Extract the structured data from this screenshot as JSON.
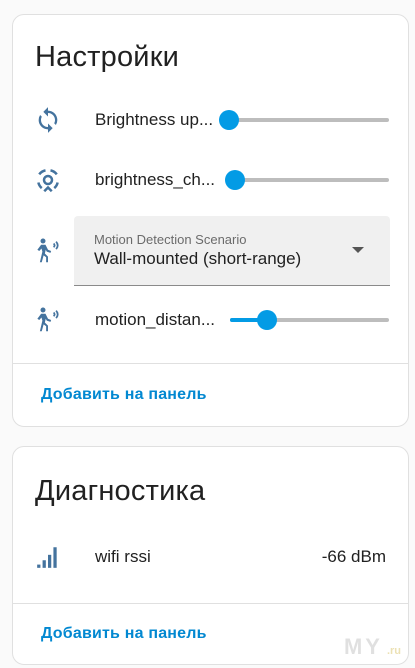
{
  "settings_card": {
    "title": "Настройки",
    "rows": [
      {
        "label": "Brightness up...",
        "icon": "sync-icon",
        "value_fraction": 0.0
      },
      {
        "label": "brightness_ch...",
        "icon": "motion-sensor-icon",
        "value_fraction": 0.05
      },
      {
        "label": "Motion Detection Scenario",
        "value": "Wall-mounted (short-range)",
        "icon": "motion-icon"
      },
      {
        "label": "motion_distan...",
        "icon": "motion-icon",
        "value_fraction": 0.23
      }
    ],
    "action": "Добавить на панель"
  },
  "diagnostics_card": {
    "title": "Диагностика",
    "rows": [
      {
        "label": "wifi rssi",
        "value": "-66 dBm",
        "icon": "signal-bars-icon"
      }
    ],
    "action": "Добавить на панель"
  },
  "watermark": {
    "text": "MY",
    "suffix": ".ru"
  },
  "colors": {
    "accent": "#039be5",
    "icon": "#44739e",
    "link": "#0288d1"
  }
}
